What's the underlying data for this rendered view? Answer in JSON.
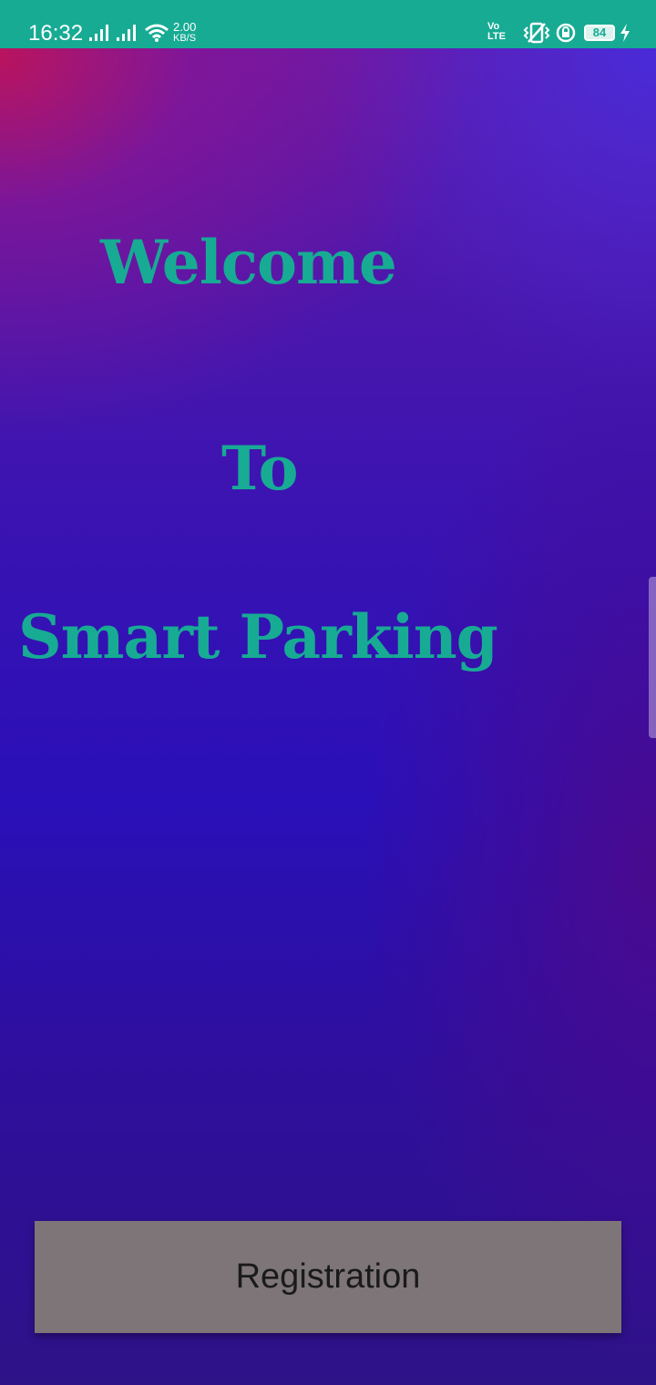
{
  "status_bar": {
    "time": "16:32",
    "speed_value": "2.00",
    "speed_unit": "KB/S",
    "volte_top": "Vo",
    "volte_bottom": "LTE",
    "battery": "84",
    "icons": [
      "signal-icon",
      "signal-icon",
      "wifi-icon",
      "volte-icon",
      "vibrate-icon",
      "rotation-lock-icon",
      "battery-icon",
      "charging-icon"
    ],
    "color": "#17ab94"
  },
  "main": {
    "line1": "Welcome",
    "line2": "To",
    "line3": "Smart Parking",
    "text_color": "#17ab94"
  },
  "actions": {
    "registration_label": "Registration",
    "button_color": "#7d7577"
  }
}
